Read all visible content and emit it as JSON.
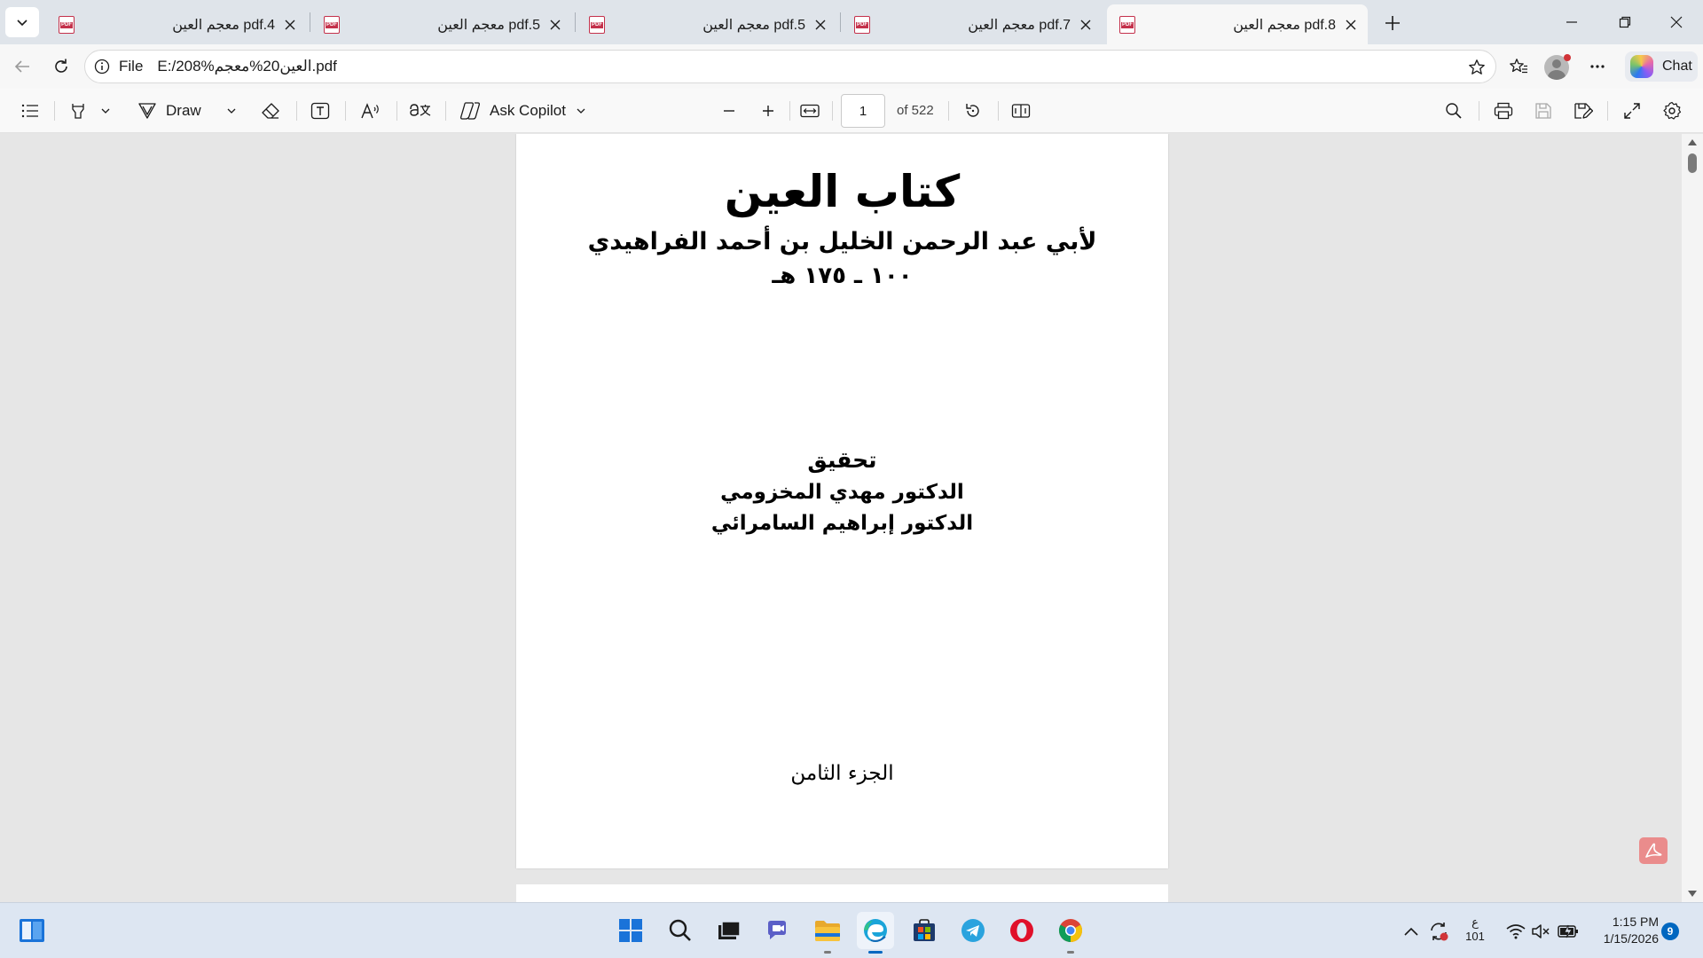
{
  "browser": {
    "tabs": [
      {
        "title": "معجم العين pdf.4",
        "active": false
      },
      {
        "title": "معجم العين pdf.5",
        "active": false
      },
      {
        "title": "معجم العين pdf.5",
        "active": false
      },
      {
        "title": "معجم العين pdf.7",
        "active": false
      },
      {
        "title": "معجم العين pdf.8",
        "active": true
      }
    ],
    "address": {
      "scheme_label": "File",
      "url": "E:/208%العين20%معجم.pdf"
    },
    "chat_label": "Chat"
  },
  "pdf_toolbar": {
    "draw_label": "Draw",
    "ask_copilot_label": "Ask Copilot",
    "page_number": "1",
    "page_total": "of 522"
  },
  "document": {
    "title": "كتاب العين",
    "author": "لأبي عبد الرحمن الخليل بن أحمد الفراهيدي",
    "dates": "١٠٠ ـ ١٧٥ هـ",
    "tahqiq": "تحقيق",
    "editor_1": "الدكتور مهدي المخزومي",
    "editor_2": "الدكتور إبراهيم السامرائي",
    "part": "الجزء الثامن"
  },
  "taskbar": {
    "apps": [
      "start-icon",
      "search-icon",
      "task-view-icon",
      "teams-icon",
      "file-explorer-icon",
      "edge-icon",
      "store-icon",
      "telegram-icon",
      "opera-icon",
      "chrome-icon"
    ],
    "lang_top": "ع",
    "lang_bottom": "101",
    "time": "1:15 PM",
    "date": "1/15/2026",
    "notifications": "9"
  },
  "colors": {
    "accent": "#0067c0",
    "pdf_red": "#c4314b",
    "tabstrip": "#dfe4ea",
    "taskbar": "#dde6f2"
  }
}
